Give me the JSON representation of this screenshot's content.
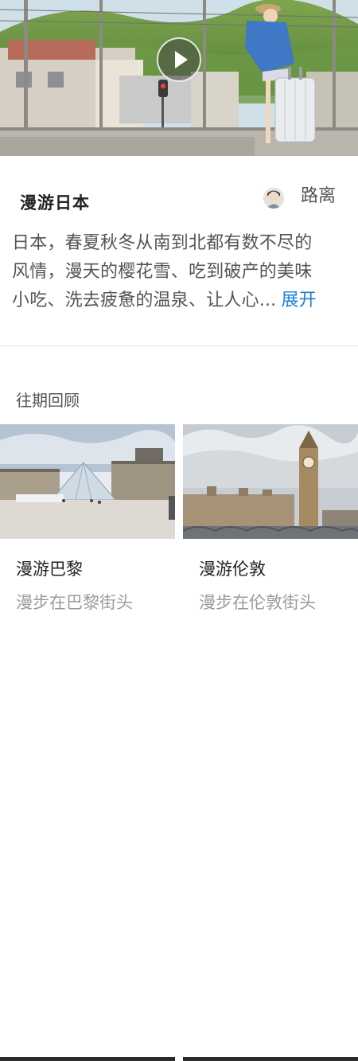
{
  "video": {
    "play_icon": "play-icon"
  },
  "trip": {
    "title": "漫游日本",
    "author": "路离",
    "description_lines": [
      "日本，春夏秋冬从南到北都有数不尽的",
      "风情，漫天的樱花雪、吃到破产的美味",
      "小吃、洗去疲惫的温泉、让人心..."
    ],
    "expand_label": "展开"
  },
  "past": {
    "section_title": "往期回顾",
    "cards": [
      {
        "title": "漫游巴黎",
        "subtitle": "漫步在巴黎街头"
      },
      {
        "title": "漫游伦敦",
        "subtitle": "漫步在伦敦街头"
      }
    ]
  },
  "colors": {
    "link": "#1e7fd8",
    "title": "#222222",
    "body_text": "#555555",
    "muted_text": "#9b9b9b"
  }
}
